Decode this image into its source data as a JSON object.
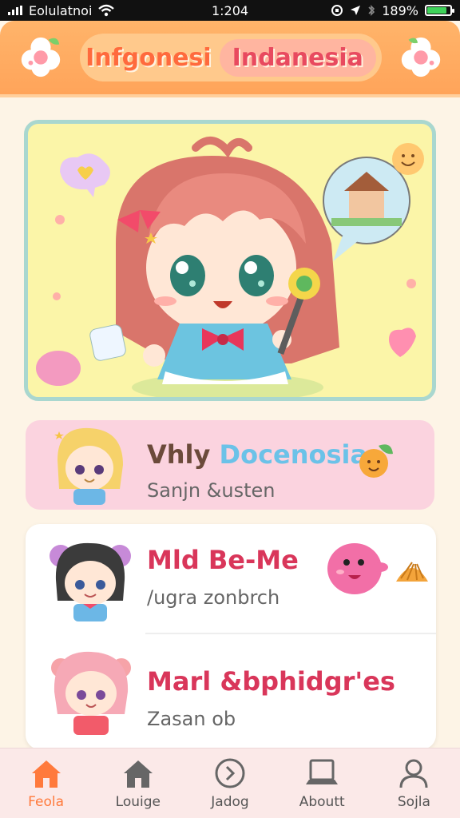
{
  "status_bar": {
    "carrier": "Eolulatnoi",
    "time": "1:204",
    "battery": "189%",
    "battery_level": 0.85
  },
  "header": {
    "title_left": "Infgonesi",
    "title_right": "Indanesia"
  },
  "featured_card": {
    "title_part1": "Vhly ",
    "title_part2": "Docenosia",
    "subtitle": "Sanjn &usten"
  },
  "list": {
    "items": [
      {
        "title": "Mld Be-Me",
        "subtitle": "/ugra zonbrch"
      },
      {
        "title": "Marl &bphidgr'es",
        "subtitle": "Zasan ob"
      }
    ]
  },
  "bottom_nav": {
    "items": [
      {
        "label": "Feola",
        "icon": "home-icon",
        "active": true
      },
      {
        "label": "Louige",
        "icon": "house-icon",
        "active": false
      },
      {
        "label": "Jadog",
        "icon": "chevron-circle-icon",
        "active": false
      },
      {
        "label": "Aboutt",
        "icon": "laptop-icon",
        "active": false
      },
      {
        "label": "Sojla",
        "icon": "user-icon",
        "active": false
      }
    ]
  },
  "colors": {
    "header": "#ffa45a",
    "accent": "#ff7a3c",
    "card_pink": "#fbd3df",
    "hero_bg": "#fbf5a8"
  }
}
